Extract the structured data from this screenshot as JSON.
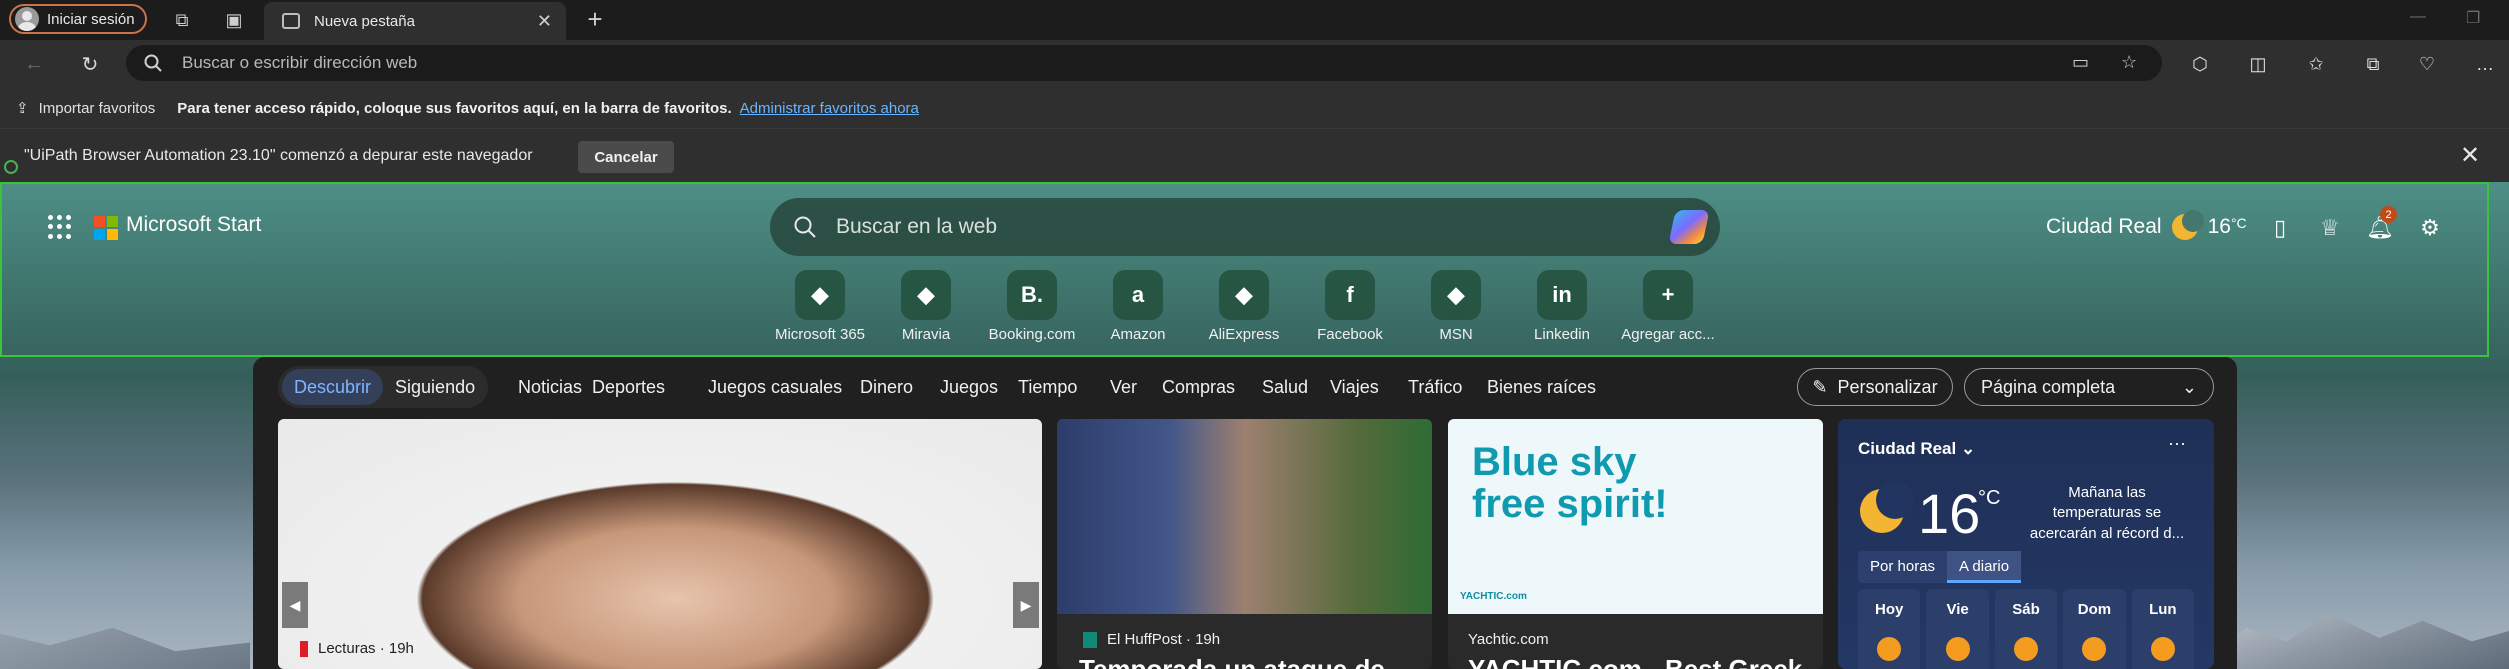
{
  "browser": {
    "profile_label": "Iniciar sesión",
    "tab_title": "Nueva pestaña",
    "address_placeholder": "Buscar o escribir dirección web"
  },
  "favorites_bar": {
    "import_label": "Importar favoritos",
    "message": "Para tener acceso rápido, coloque sus favoritos aquí, en la barra de favoritos.",
    "manage_link": "Administrar favoritos ahora"
  },
  "infobar": {
    "message": "\"UiPath Browser Automation 23.10\" comenzó a depurar este navegador",
    "cancel_label": "Cancelar"
  },
  "start": {
    "brand": "Microsoft Start",
    "search_placeholder": "Buscar en la web",
    "location": "Ciudad Real",
    "temperature": "16",
    "temp_unit": "°C",
    "notification_count": "2",
    "quick_links": [
      {
        "label": "Microsoft 365",
        "icon": "microsoft-365-icon"
      },
      {
        "label": "Miravia",
        "icon": "miravia-icon"
      },
      {
        "label": "Booking.com",
        "icon": "booking-icon",
        "glyph": "B."
      },
      {
        "label": "Amazon",
        "icon": "amazon-icon",
        "glyph": "a"
      },
      {
        "label": "AliExpress",
        "icon": "aliexpress-icon"
      },
      {
        "label": "Facebook",
        "icon": "facebook-icon",
        "glyph": "f"
      },
      {
        "label": "MSN",
        "icon": "msn-icon"
      },
      {
        "label": "Linkedin",
        "icon": "linkedin-icon",
        "glyph": "in"
      },
      {
        "label": "Agregar acc...",
        "icon": "add-icon",
        "glyph": "+"
      }
    ]
  },
  "feed": {
    "tabs": {
      "active": "Descubrir",
      "other": "Siguiendo"
    },
    "categories": [
      "Noticias",
      "Deportes",
      "Juegos casuales",
      "Dinero",
      "Juegos",
      "Tiempo",
      "Ver",
      "Compras",
      "Salud",
      "Viajes",
      "Tráfico",
      "Bienes raíces"
    ],
    "personalize_label": "Personalizar",
    "view_select": "Página completa",
    "hero": {
      "source": "Lecturas · 19h"
    },
    "card2": {
      "source": "El HuffPost · 19h",
      "headline": "Temporada un ataque de"
    },
    "card3": {
      "ad_title": "Blue sky free spirit!",
      "ad_brand": "YACHTIC.com",
      "source": "Yachtic.com",
      "headline": "YACHTIC.com - Best Greek"
    }
  },
  "weather": {
    "location": "Ciudad Real",
    "temperature": "16",
    "unit": "°C",
    "note": "Mañana las temperaturas se acercarán al récord d...",
    "tabs": [
      "Por horas",
      "A diario"
    ],
    "days": [
      "Hoy",
      "Vie",
      "Sáb",
      "Dom",
      "Lun"
    ]
  },
  "colors": {
    "accent": "#7fb4ff",
    "profile_border": "#c8754b",
    "link": "#6ab4ff",
    "highlight": "#3ac43a"
  }
}
